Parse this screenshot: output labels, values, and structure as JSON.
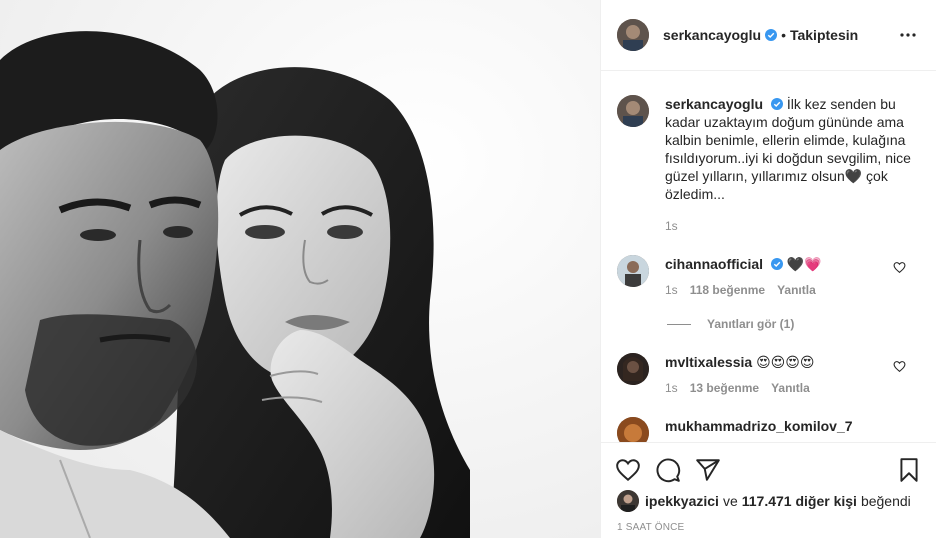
{
  "post": {
    "author": {
      "username": "serkancayoglu",
      "verified": true,
      "follow_status": "Takiptesin",
      "separator": "•"
    },
    "caption": {
      "username": "serkancayoglu",
      "text": "İlk kez senden bu kadar uzaktayım doğum gününde ama kalbin benimle, ellerin elimde, kulağına fısıldıyorum..iyi ki doğdun sevgilim, nice güzel yılların, yıllarımız olsun🖤 çok özledim...",
      "time": "1s"
    },
    "comments": [
      {
        "username": "cihannaofficial",
        "verified": true,
        "text": "🖤💗",
        "time": "1s",
        "likes": "118 beğenme",
        "reply_label": "Yanıtla",
        "view_replies": "Yanıtları gör (1)"
      },
      {
        "username": "mvltixalessia",
        "verified": false,
        "text": "😍😍😍😍",
        "time": "1s",
        "likes": "13 beğenme",
        "reply_label": "Yanıtla"
      },
      {
        "username": "mukhammadrizo_komilov_7",
        "verified": false,
        "text": ""
      }
    ],
    "likes": {
      "liker": "ipekkyazici",
      "connector": "ve",
      "count_text": "117.471 diğer kişi",
      "suffix": "beğendi"
    },
    "timestamp": "1 SAAT ÖNCE"
  },
  "icons": {
    "more": "more-options-icon",
    "like": "heart-icon",
    "comment": "comment-icon",
    "share": "share-icon",
    "save": "bookmark-icon",
    "verified": "verified-badge-icon"
  },
  "colors": {
    "verified_blue": "#3897f0",
    "text": "#262626",
    "secondary": "#8e8e8e",
    "border": "#efefef"
  }
}
